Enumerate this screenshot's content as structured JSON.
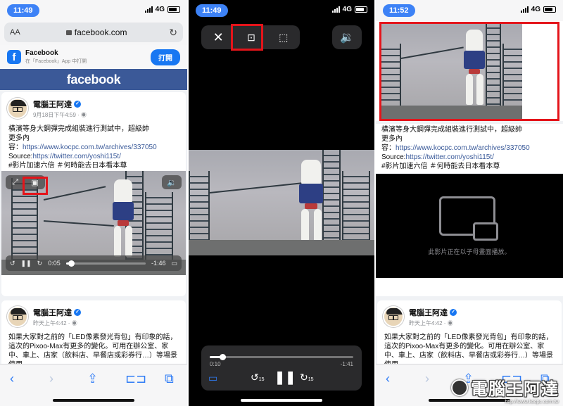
{
  "panels": [
    {
      "time": "11:49",
      "network": "4G",
      "browser": {
        "text_size": "AA",
        "url": "facebook.com"
      },
      "app_banner": {
        "title": "Facebook",
        "subtitle": "在「Facebook」App 中打開",
        "open_button": "打開"
      },
      "site_header": "facebook",
      "post1": {
        "author": "電腦王阿達",
        "meta": "9月18日下午4:59 · ",
        "text_line1": "橫濱等身大鋼彈完成組裝進行測試中，超級帥",
        "text_line2": "更多內",
        "text_line3_prefix": "容：",
        "link1": "https://www.kocpc.com.tw/archives/337050",
        "source_prefix": "Source:",
        "link2": "https://twitter.com/yoshi115t/",
        "hashtags": "#影片加速六倍 ＃何時能去日本看本尊"
      },
      "video": {
        "elapsed": "0:05",
        "remaining": "-1:46",
        "progress": 0.05
      },
      "post2": {
        "author": "電腦王阿達",
        "meta": "昨天上午4:42 · ",
        "line1": "如果大家對之前的「LED像素發光背包」有印象的話，",
        "line2": "這次的Pixoo-Max有更多的變化。可用在辦公室、家",
        "line3": "中、車上、店家（飲料店、早餐店或彩券行…）等場景",
        "line4": "使用。"
      }
    },
    {
      "time": "11:49",
      "network": "4G",
      "video": {
        "elapsed": "0:10",
        "remaining": "-1:41",
        "progress": 0.09,
        "skip_seconds": "15"
      }
    },
    {
      "time": "11:52",
      "network": "4G",
      "post1": {
        "text_line1": "橫濱等身大鋼彈完成組裝進行測試中，超級帥",
        "text_line2": "更多內",
        "text_line3_prefix": "容：",
        "link1": "https://www.kocpc.com.tw/archives/337050",
        "source_prefix": "Source:",
        "link2": "https://twitter.com/yoshi115t/",
        "hashtags": "#影片加速六倍 ＃何時能去日本看本尊"
      },
      "pip_notice": "此影片正在以子母畫面播放。",
      "post2": {
        "author": "電腦王阿達",
        "meta": "昨天上午4:42 · ",
        "line1": "如果大家對之前的「LED像素發光背包」有印象的話，",
        "line2": "這次的Pixoo-Max有更多的變化。可用在辦公室、家",
        "line3": "中、車上、店家（飲料店、早餐店或彩券行…）等場景",
        "line4": "使用。"
      }
    }
  ],
  "watermark": {
    "brand": "電腦王阿達",
    "url": "http://www.kocpc.com.tw"
  },
  "colors": {
    "fb_blue": "#3b5998",
    "ios_blue": "#2f7cf6",
    "highlight_red": "#e4141a"
  },
  "icons": [
    "signal-icon",
    "battery-icon",
    "lock-icon",
    "reload-icon",
    "facebook-app-icon",
    "verified-icon",
    "globe-icon",
    "pip-icon",
    "fullscreen-icon",
    "volume-icon",
    "close-icon",
    "expand-icon",
    "skip-back-15-icon",
    "skip-forward-15-icon",
    "pause-icon",
    "airplay-icon",
    "back-icon",
    "forward-icon",
    "share-icon",
    "bookmarks-icon",
    "tabs-icon"
  ]
}
